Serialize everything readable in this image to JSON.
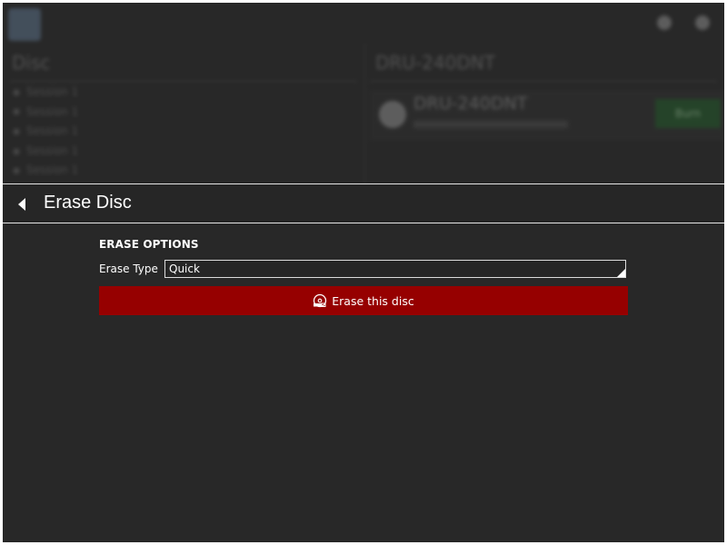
{
  "background": {
    "left_title": "Disc",
    "right_title": "DRU-240DNT",
    "list_items": [
      "Session 1",
      "Session 1",
      "Session 1",
      "Session 1",
      "Session 1"
    ],
    "device_name": "DRU-240DNT",
    "action_label": "Burn"
  },
  "panel": {
    "title": "Erase Disc",
    "section_heading": "ERASE OPTIONS",
    "erase_type_label": "Erase Type",
    "erase_type_value": "Quick",
    "erase_button_label": "Erase this disc"
  },
  "colors": {
    "background": "#282828",
    "erase_button": "#960000",
    "text": "#ffffff"
  },
  "icons": {
    "back": "back-arrow-icon",
    "erase": "erase-disc-icon"
  }
}
